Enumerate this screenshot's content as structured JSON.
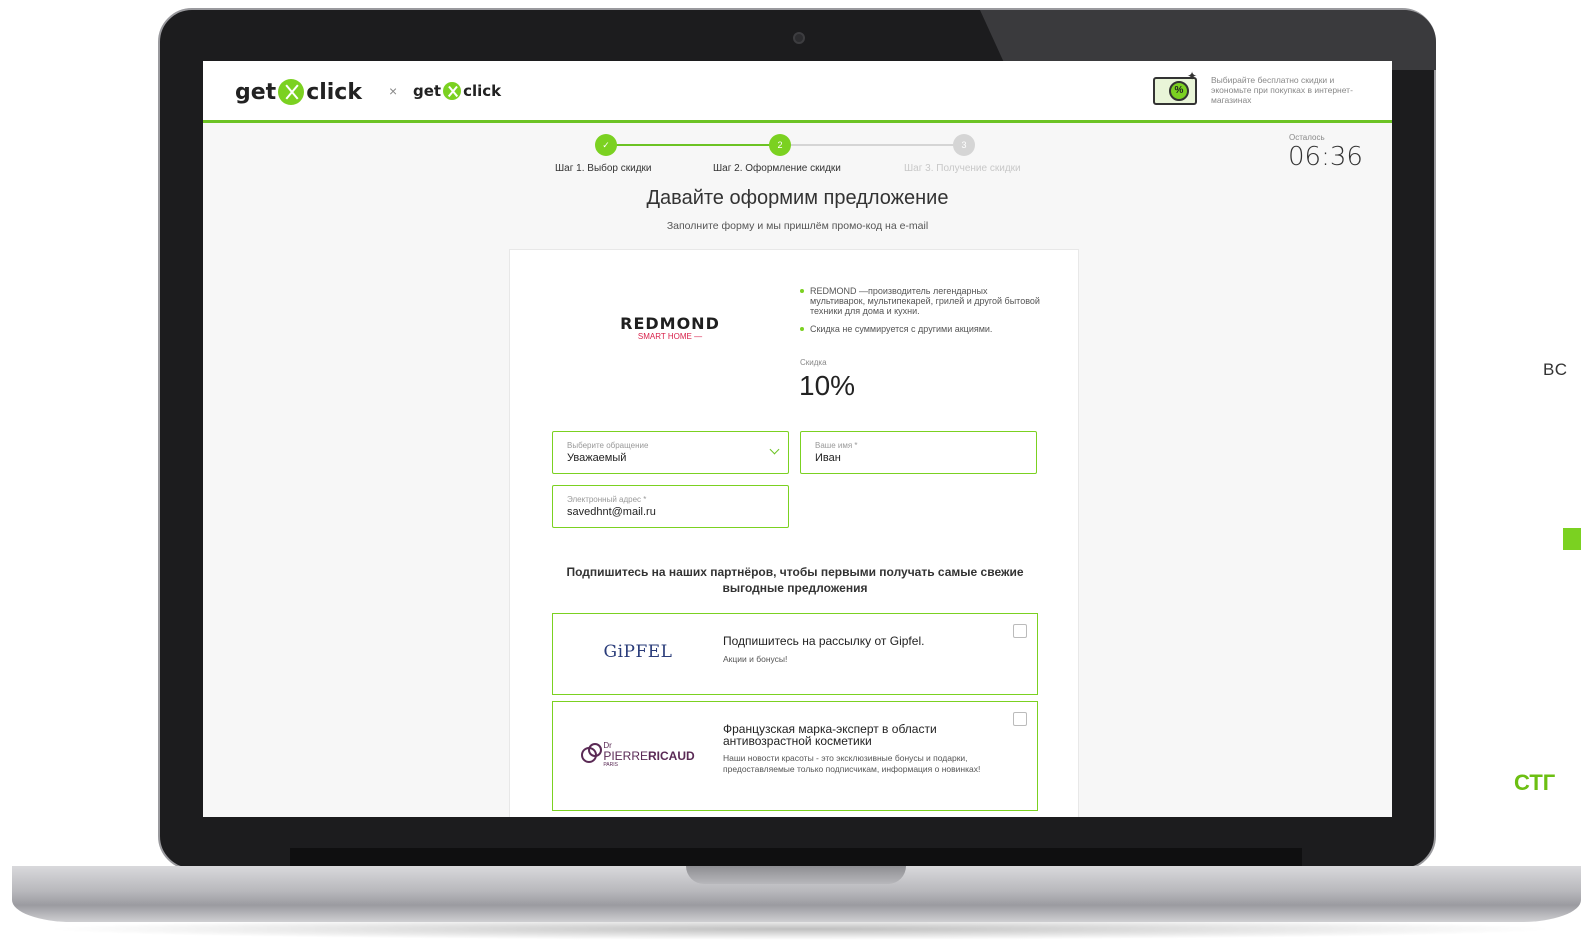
{
  "header": {
    "logo_main": [
      "get",
      "click"
    ],
    "times": "×",
    "logo_sub": [
      "get",
      "click"
    ],
    "promo_text": "Выбирайте бесплатно скидки и экономьте при покупках в интернет-магазинах",
    "promo_icon": "percent-ticket-icon",
    "accent_color": "#7bd121"
  },
  "stepper": {
    "steps": [
      {
        "label": "Шаг 1.  Выбор скидки",
        "state": "done",
        "mark": "✓"
      },
      {
        "label": "Шаг 2.  Оформление скидки",
        "state": "current",
        "mark": "2"
      },
      {
        "label": "Шаг 3.  Получение скидки",
        "state": "pending",
        "mark": "3"
      }
    ]
  },
  "timer": {
    "label": "Осталось",
    "value": "06:36"
  },
  "main": {
    "title": "Давайте оформим предложение",
    "subtitle": "Заполните форму и мы пришлём промо-код на e-mail"
  },
  "offer": {
    "brand": "REDMOND",
    "brand_tag": "SMART HOME —",
    "facts": [
      "REDMOND —производитель легендарных мультиварок, мультипекарей, грилей и другой бытовой техники для дома и кухни.",
      "Скидка не суммируется с другими акциями."
    ],
    "discount_label": "Скидка",
    "discount_value": "10%"
  },
  "form": {
    "greeting": {
      "label": "Выберите обращение",
      "value": "Уважаемый"
    },
    "name": {
      "label": "Ваше имя *",
      "value": "Иван"
    },
    "email": {
      "label": "Электронный адрес *",
      "value": "savedhnt@mail.ru"
    }
  },
  "subscribe": {
    "heading": "Подпишитесь на наших партнёров, чтобы первыми получать самые свежие выгодные предложения",
    "partners": [
      {
        "logo": "GiPFEL",
        "title": "Подпишитесь на рассылку от Gipfel.",
        "desc": "Акции и бонусы!",
        "checked": false
      },
      {
        "logo_line1": "Dr",
        "logo_line2": "PIERRE",
        "logo_line2b": "RICAUD",
        "logo_line3": "PARIS",
        "title": "Французская марка-эксперт в области антивозрастной косметики",
        "desc": "Наши новости красоты - это эксклюзивные бонусы и подарки, предоставляемые только подписчикам, информация о новинках!",
        "checked": false
      }
    ]
  },
  "side": {
    "text1": "ВС",
    "text3": "СТГ"
  }
}
